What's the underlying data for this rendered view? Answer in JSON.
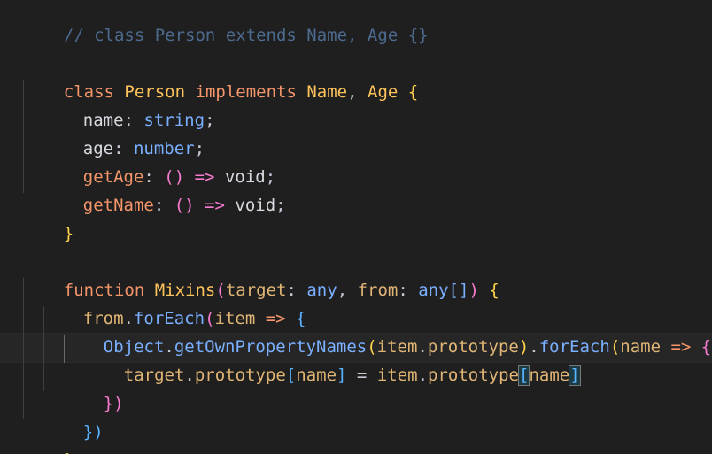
{
  "code": {
    "comment_line": "// class Person extends Name, Age {}",
    "class_kw": "class",
    "class_name": "Person",
    "implements_kw": "implements",
    "iface1": "Name",
    "comma_sep": ", ",
    "iface2": "Age",
    "open_brace": "{",
    "close_brace": "}",
    "name_prop": "name",
    "string_type": "string",
    "age_prop": "age",
    "number_type": "number",
    "getage_prop": "getAge",
    "getname_prop": "getName",
    "arrow_fn": "() => ",
    "void_type": "void",
    "colon": ": ",
    "semicolon": ";",
    "function_kw": "function",
    "mixins_name": "Mixins",
    "open_paren": "(",
    "close_paren": ")",
    "target_param": "target",
    "any_type": "any",
    "from_param": "from",
    "any_array_type": "any[]",
    "rest_params": "{",
    "foreach_method": "forEach",
    "item_param": "item",
    "arrow": " => ",
    "object_id": "Object",
    "getownpropertynames": "getOwnPropertyNames",
    "prototype_prop": "prototype",
    "name_param": "name",
    "dot": ".",
    "assign": " = ",
    "open_bracket": "[",
    "close_bracket": "]",
    "close_foreach_inner": "})",
    "close_foreach_outer": "})"
  }
}
